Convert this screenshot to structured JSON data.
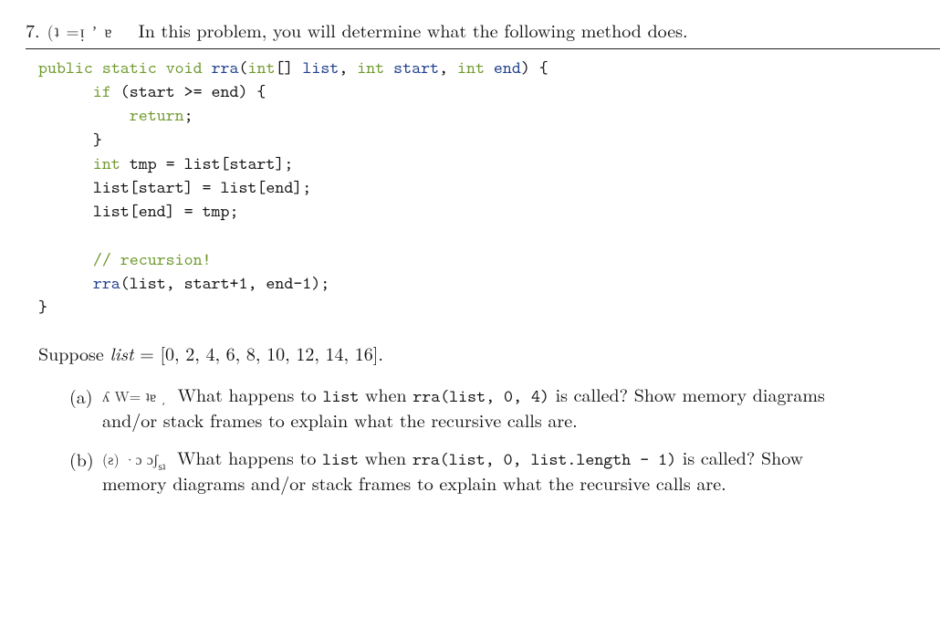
{
  "problem": {
    "number": "7.",
    "header_artifact": "(ʇ =ᴉ ʼ ɐ",
    "intro": "In this problem, you will determine what the following method does."
  },
  "code": {
    "sig_public": "public",
    "sig_static": "static",
    "sig_void": "void",
    "sig_fn": "rra",
    "sig_open": "(",
    "sig_int": "int",
    "sig_arr": "[]",
    "sig_p1": "list",
    "sig_c1": ", ",
    "sig_int2": "int",
    "sig_p2": "start",
    "sig_c2": ", ",
    "sig_int3": "int",
    "sig_p3": "end",
    "sig_close": ") {",
    "if_kw": "if",
    "if_cond": " (start >= end) {",
    "ret_kw": "return",
    "ret_semi": ";",
    "brace_close1": "}",
    "decl_int": "int",
    "decl_rest": " tmp = list[start];",
    "line_swap2": "list[start] = list[end];",
    "line_swap3": "list[end] = tmp;",
    "comment": "// recursion!",
    "rec_fn": "rra",
    "rec_args": "(list, start+1, end-1);",
    "brace_close2": "}"
  },
  "suppose": {
    "prefix": "Suppose ",
    "var": "list",
    "eq": " = [0, 2, 4, 6, 8, 10, 12, 14, 16]."
  },
  "parts": {
    "a": {
      "label": "(a)",
      "artifact": "ʎ W= ʇɐ  ͵",
      "t1": "What happens to ",
      "m1": "list",
      "t2": " when ",
      "m2": "rra(list, 0, 4)",
      "t3": " is called? Show memory diagrams and/or stack frames to explain what the recursive calls are."
    },
    "b": {
      "label": "(b)",
      "artifact_main": "(ƨ) ·ɔ   ɔʃ",
      "artifact_sub": "ѕʇ",
      "t1": "What happens to ",
      "m1": "list",
      "t2": " when ",
      "m2": "rra(list, 0, list.length - 1)",
      "t3": " is called? Show memory diagrams and/or stack frames to explain what the recursive calls are."
    }
  }
}
